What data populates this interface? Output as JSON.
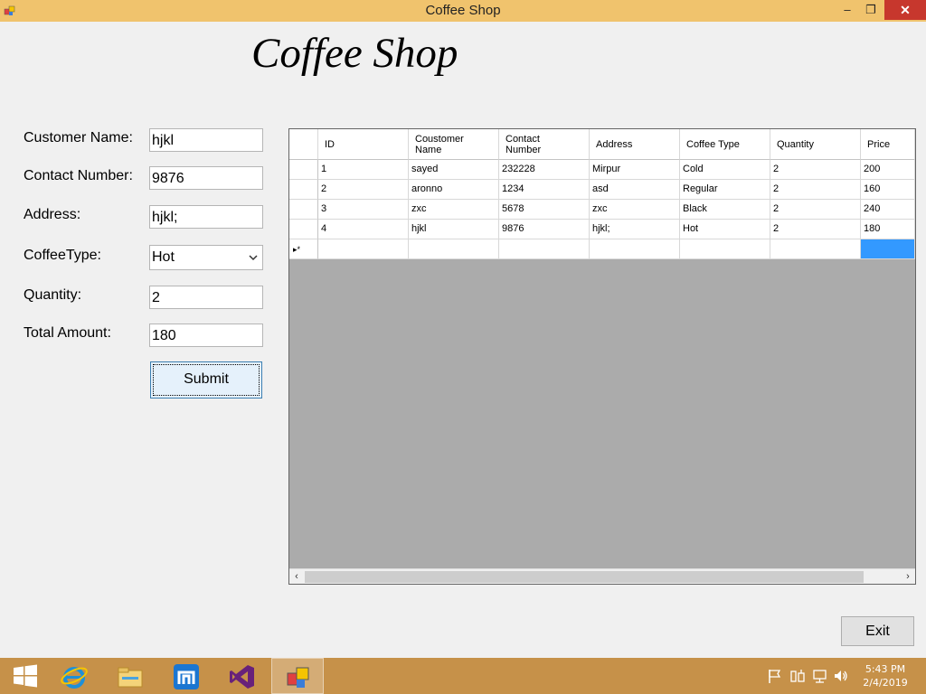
{
  "window": {
    "title": "Coffee Shop"
  },
  "heading": "Coffee Shop",
  "form": {
    "customer_name_label": "Customer Name:",
    "customer_name_value": "hjkl",
    "contact_number_label": "Contact Number:",
    "contact_number_value": "9876",
    "address_label": "Address:",
    "address_value": "hjkl;",
    "coffee_type_label": "CoffeeType:",
    "coffee_type_value": "Hot",
    "quantity_label": "Quantity:",
    "quantity_value": "2",
    "total_amount_label": "Total Amount:",
    "total_amount_value": "180",
    "submit_label": "Submit"
  },
  "grid": {
    "columns": [
      {
        "line1": "ID",
        "line2": ""
      },
      {
        "line1": "Coustomer",
        "line2": "Name"
      },
      {
        "line1": "Contact",
        "line2": "Number"
      },
      {
        "line1": "Address",
        "line2": ""
      },
      {
        "line1": "Coffee Type",
        "line2": ""
      },
      {
        "line1": "Quantity",
        "line2": ""
      },
      {
        "line1": "Price",
        "line2": ""
      }
    ],
    "rows": [
      [
        "1",
        "sayed",
        "232228",
        "Mirpur",
        "Cold",
        "2",
        "200"
      ],
      [
        "2",
        "aronno",
        "1234",
        "asd",
        "Regular",
        "2",
        "160"
      ],
      [
        "3",
        "zxc",
        "5678",
        "zxc",
        "Black",
        "2",
        "240"
      ],
      [
        "4",
        "hjkl",
        "9876",
        "hjkl;",
        "Hot",
        "2",
        "180"
      ]
    ],
    "new_row_marker": "▸*"
  },
  "exit_label": "Exit",
  "taskbar": {
    "time": "5:43 PM",
    "date": "2/4/2019"
  },
  "colors": {
    "titlebar": "#f0c36d",
    "close_button": "#c7372d",
    "taskbar": "#c69149",
    "selection": "#3399ff"
  }
}
